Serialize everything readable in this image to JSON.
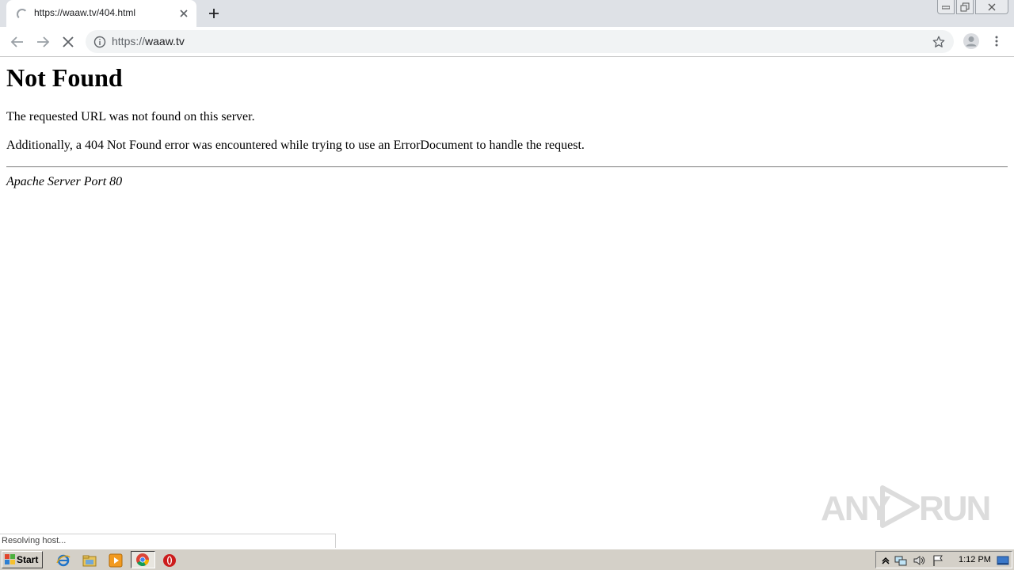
{
  "browser": {
    "tab_title": "https://waaw.tv/404.html",
    "url_scheme": "https://",
    "url_host": "waaw.tv"
  },
  "page": {
    "heading": "Not Found",
    "paragraph1": "The requested URL was not found on this server.",
    "paragraph2": "Additionally, a 404 Not Found error was encountered while trying to use an ErrorDocument to handle the request.",
    "address": "Apache Server Port 80"
  },
  "status": "Resolving host...",
  "watermark": {
    "left": "ANY",
    "right": "RUN"
  },
  "taskbar": {
    "start_label": "Start",
    "clock": "1:12 PM",
    "apps": [
      "ie-icon",
      "explorer-icon",
      "media-player-icon",
      "chrome-icon",
      "opera-icon"
    ]
  },
  "colors": {
    "tabstrip": "#dee1e6",
    "omnibox": "#f1f3f4",
    "taskbar": "#d4d0c8"
  }
}
